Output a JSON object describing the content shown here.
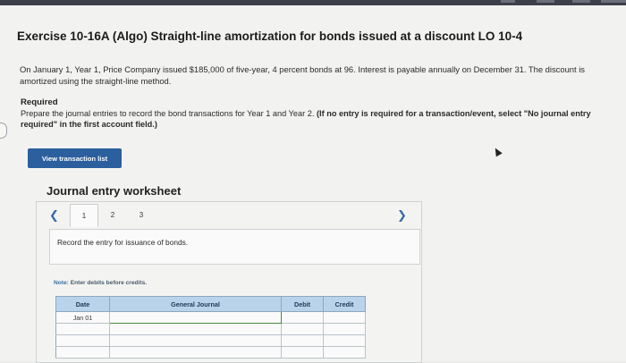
{
  "exercise": {
    "title": "Exercise 10-16A (Algo) Straight-line amortization for bonds issued at a discount LO 10-4",
    "description": "On January 1, Year 1, Price Company issued $185,000 of five-year, 4 percent bonds at 96. Interest is payable annually on December 31. The discount is amortized using the straight-line method.",
    "required_heading": "Required",
    "required_text": "Prepare the journal entries to record the bond transactions for Year 1 and Year 2.",
    "required_bold": "(If no entry is required for a transaction/event, select \"No journal entry required\" in the first account field.)"
  },
  "buttons": {
    "view_transaction_list": "View transaction list"
  },
  "worksheet": {
    "title": "Journal entry worksheet",
    "pages": [
      "1",
      "2",
      "3"
    ],
    "active_page": 1,
    "instruction": "Record the entry for issuance of bonds.",
    "note_label": "Note:",
    "note_text": "Enter debits before credits.",
    "table": {
      "headers": [
        "Date",
        "General Journal",
        "Debit",
        "Credit"
      ],
      "rows": [
        [
          "Jan 01",
          "",
          "",
          ""
        ],
        [
          "",
          "",
          "",
          ""
        ],
        [
          "",
          "",
          "",
          ""
        ],
        [
          "",
          "",
          "",
          ""
        ]
      ]
    }
  },
  "colors": {
    "button_bg": "#2b5f9e",
    "table_header": "#b9d3ea",
    "link_blue": "#3b6aa8"
  }
}
